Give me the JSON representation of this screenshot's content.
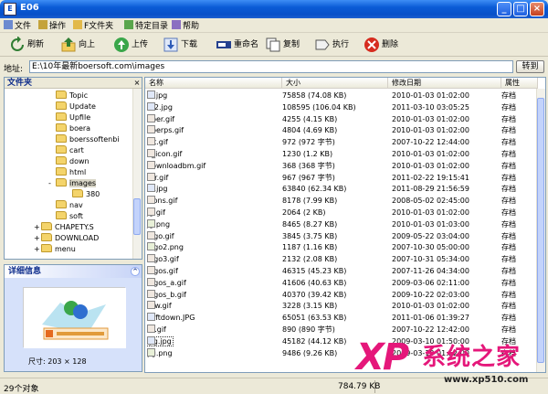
{
  "window": {
    "title": "E06",
    "app_icon": "E"
  },
  "menu": [
    "文件",
    "操作",
    "F文件夹",
    "特定目录",
    "帮助"
  ],
  "toolbar": [
    "刷新",
    "向上",
    "上传",
    "下载",
    "重命名",
    "复制",
    "执行",
    "删除"
  ],
  "address": {
    "label": "地址:",
    "value": "E:\\10年最新boersoft.com\\images",
    "go": "转到"
  },
  "folders": {
    "header": "文件夹",
    "items": [
      "Topic",
      "Update",
      "Upfile",
      "boera",
      "boerssoftenbi",
      "cart",
      "down",
      "html",
      "images",
      "380",
      "nav",
      "soft",
      "CHAPETY.S",
      "DOWNLOAD",
      "menu"
    ]
  },
  "details": {
    "header": "详细信息",
    "size_label": "尺寸: 203 × 128"
  },
  "files": {
    "columns": [
      "名称",
      "大小",
      "修改日期",
      "属性"
    ],
    "rows": [
      [
        "bf.jpg",
        "75858 (74.08 KB)",
        "2010-01-03 01:02:00",
        "存档"
      ],
      [
        "bf2.jpg",
        "108595 (106.04 KB)",
        "2011-03-10 03:05:25",
        "存档"
      ],
      [
        "boer.gif",
        "4255 (4.15 KB)",
        "2010-01-03 01:02:00",
        "存档"
      ],
      [
        "boerps.gif",
        "4804 (4.69 KB)",
        "2010-01-03 01:02:00",
        "存档"
      ],
      [
        "cft.gif",
        "972 (972 字节)",
        "2007-10-22 12:44:00",
        "存档"
      ],
      [
        "d_icon.gif",
        "1230 (1.2 KB)",
        "2010-01-03 01:02:00",
        "存档"
      ],
      [
        "downloadbm.gif",
        "368 (368 字节)",
        "2010-01-03 01:02:00",
        "存档"
      ],
      [
        "err.gif",
        "967 (967 字节)",
        "2011-02-22 19:15:41",
        "存档"
      ],
      [
        "fx.jpg",
        "63840 (62.34 KB)",
        "2011-08-29 21:56:59",
        "存档"
      ],
      [
        "icons.gif",
        "8178 (7.99 KB)",
        "2008-05-02 02:45:00",
        "存档"
      ],
      [
        "jg.gif",
        "2064 (2 KB)",
        "2010-01-03 01:02:00",
        "存档"
      ],
      [
        "jg.png",
        "8465 (8.27 KB)",
        "2010-01-03 01:03:00",
        "存档"
      ],
      [
        "logo.gif",
        "3845 (3.75 KB)",
        "2009-05-22 03:04:00",
        "存档"
      ],
      [
        "logo2.png",
        "1187 (1.16 KB)",
        "2007-10-30 05:00:00",
        "存档"
      ],
      [
        "logo3.gif",
        "2132 (2.08 KB)",
        "2007-10-31 05:34:00",
        "存档"
      ],
      [
        "logos.gif",
        "46315 (45.23 KB)",
        "2007-11-26 04:34:00",
        "存档"
      ],
      [
        "logos_a.gif",
        "41606 (40.63 KB)",
        "2009-03-06 02:11:00",
        "存档"
      ],
      [
        "logos_b.gif",
        "40370 (39.42 KB)",
        "2009-10-22 02:03:00",
        "存档"
      ],
      [
        "raw.gif",
        "3228 (3.15 KB)",
        "2010-01-03 01:02:00",
        "存档"
      ],
      [
        "softdown.JPG",
        "65051 (63.53 KB)",
        "2011-01-06 01:39:27",
        "存档"
      ],
      [
        "tb.gif",
        "890 (890 字节)",
        "2007-10-22 12:42:00",
        "存档"
      ],
      [
        "yg.jpg",
        "45182 (44.12 KB)",
        "2009-03-10 01:50:00",
        "存档"
      ],
      [
        "yg.png",
        "9486 (9.26 KB)",
        "2009-03-10 01:52:00",
        "存档"
      ]
    ]
  },
  "status": {
    "left": "29个对象",
    "size": "784.79 KB"
  },
  "watermark": {
    "brand": "XP",
    "name": "系统之家",
    "url": "www.xp510.com"
  },
  "colors": {
    "title_blue": "#0a5bd6",
    "accent_pink": "#e5177a"
  }
}
